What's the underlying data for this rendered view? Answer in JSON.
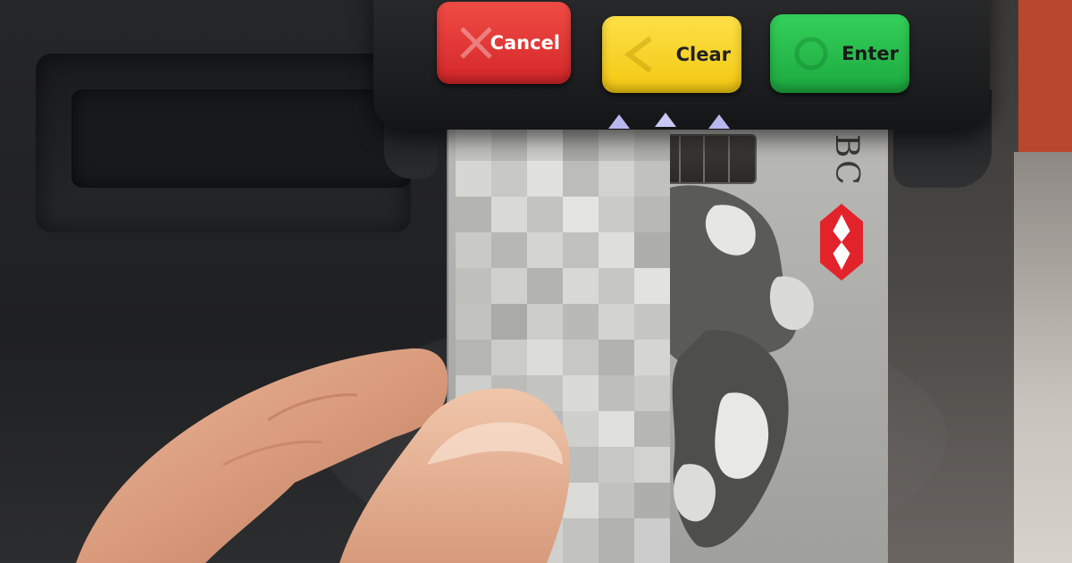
{
  "pinpad": {
    "keys": {
      "cancel_label": "Cancel",
      "clear_label": "Clear",
      "enter_label": "Enter"
    }
  },
  "card": {
    "bank_text": "BC",
    "logo_icon": "hexagon-logo-icon",
    "obscured": true
  },
  "colors": {
    "cancel": "#e0342f",
    "clear": "#f7d51c",
    "enter": "#28bd4b",
    "logo_red": "#e3232b",
    "indicator": "#b9b7f0"
  }
}
